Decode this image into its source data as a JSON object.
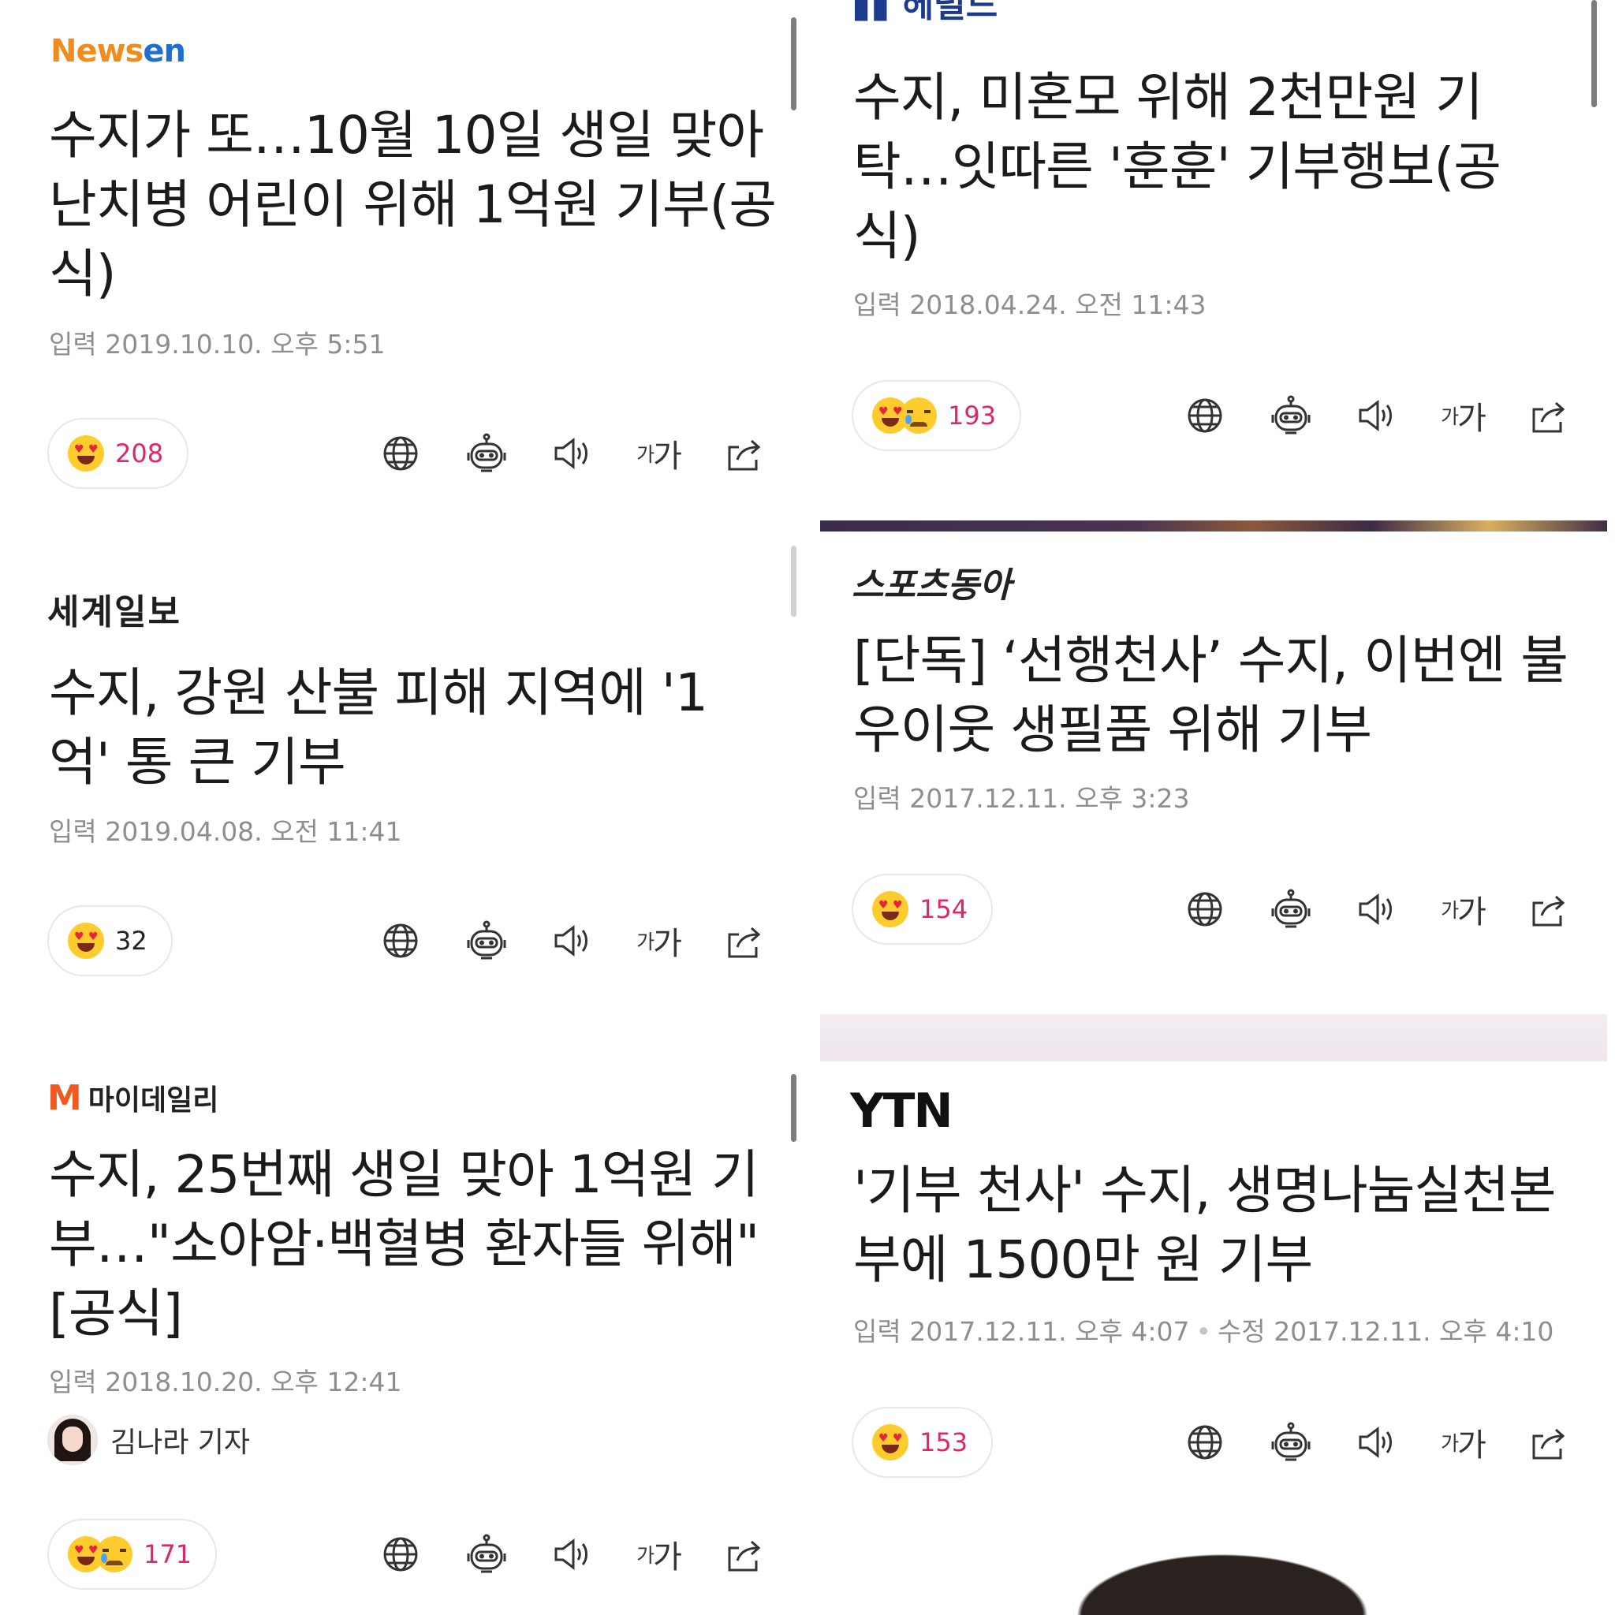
{
  "tool_icons": [
    "globe-icon",
    "robot-summary-icon",
    "speaker-icon",
    "font-size-icon",
    "share-icon"
  ],
  "font_size_label": {
    "small": "가",
    "large": "가"
  },
  "articles": [
    {
      "press": "Newsen",
      "headline": "수지가 또…10월 10일 생일 맞아 난치병 어린이 위해 1억원 기부(공식)",
      "input_label": "입력",
      "input_time": "2019.10.10. 오후 5:51",
      "reaction_count": "208"
    },
    {
      "press": "헤럴드POP",
      "headline": "수지, 미혼모 위해 2천만원 기탁…잇따른 '훈훈' 기부행보(공식)",
      "input_label": "입력",
      "input_time": "2018.04.24. 오전 11:43",
      "reaction_count": "193"
    },
    {
      "press": "세계일보",
      "headline": "수지, 강원 산불 피해 지역에 '1억' 통 큰 기부",
      "input_label": "입력",
      "input_time": "2019.04.08. 오전 11:41",
      "reaction_count": "32"
    },
    {
      "press": "스포츠동아",
      "headline": "[단독] ‘선행천사’ 수지, 이번엔 불우이웃 생필품 위해 기부",
      "input_label": "입력",
      "input_time": "2017.12.11. 오후 3:23",
      "reaction_count": "154"
    },
    {
      "press": "마이데일리",
      "headline": "수지, 25번째 생일 맞아 1억원 기부…\"소아암·백혈병 환자들 위해\" [공식]",
      "input_label": "입력",
      "input_time": "2018.10.20. 오후 12:41",
      "author": "김나라 기자",
      "reaction_count": "171"
    },
    {
      "press": "YTN",
      "headline": "'기부 천사' 수지, 생명나눔실천본부에 1500만 원 기부",
      "input_label": "입력",
      "input_time": "2017.12.11. 오후 4:07",
      "modified_label": "수정",
      "modified_time": "2017.12.11. 오후 4:10",
      "reaction_count": "153"
    }
  ],
  "colors": {
    "reaction_count": "#e0246e",
    "meta": "#8e8e8e",
    "newsen_orange": "#f08c1e",
    "newsen_blue": "#1f6fd1",
    "mydaily_orange": "#f05a1e"
  }
}
